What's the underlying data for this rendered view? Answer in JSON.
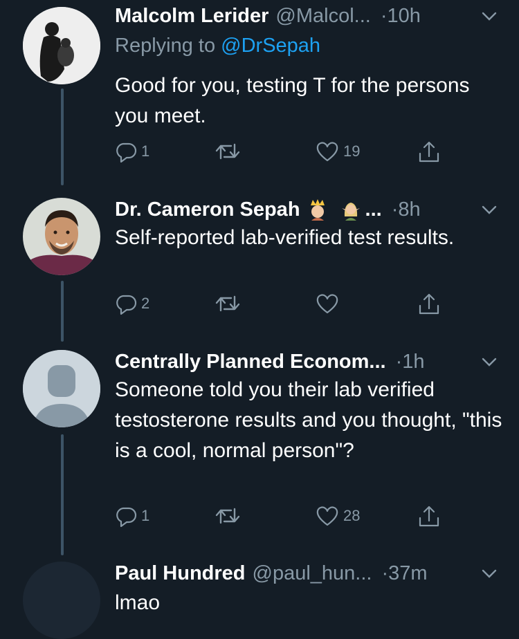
{
  "tweets": [
    {
      "name": "Malcolm Lerider",
      "handle": "@Malcol...",
      "time": "·10h",
      "reply_prefix": "Replying to ",
      "reply_mention": "@DrSepah",
      "text": "Good for you, testing T for the persons you meet.",
      "replies": "1",
      "retweets": "",
      "likes": "19"
    },
    {
      "name": "Dr. Cameron Sepah",
      "name_suffix": "...",
      "time": "·8h",
      "text": "Self-reported lab-verified test results.",
      "replies": "2",
      "retweets": "",
      "likes": ""
    },
    {
      "name": "Centrally Planned Econom...",
      "time": "·1h",
      "text": "Someone told you their lab verified testosterone results and you thought, \"this is a cool, normal person\"?",
      "replies": "1",
      "retweets": "",
      "likes": "28"
    },
    {
      "name": "Paul Hundred",
      "handle": "@paul_hun...",
      "time": "·37m",
      "text": "lmao"
    }
  ],
  "colors": {
    "background": "#141d26",
    "secondary_text": "#8899a6",
    "link": "#1da1f2",
    "thread_line": "#3d5466"
  },
  "icons": [
    "reply-icon",
    "retweet-icon",
    "like-icon",
    "share-icon",
    "chevron-down-icon",
    "crown-emoji",
    "elf-emoji"
  ]
}
